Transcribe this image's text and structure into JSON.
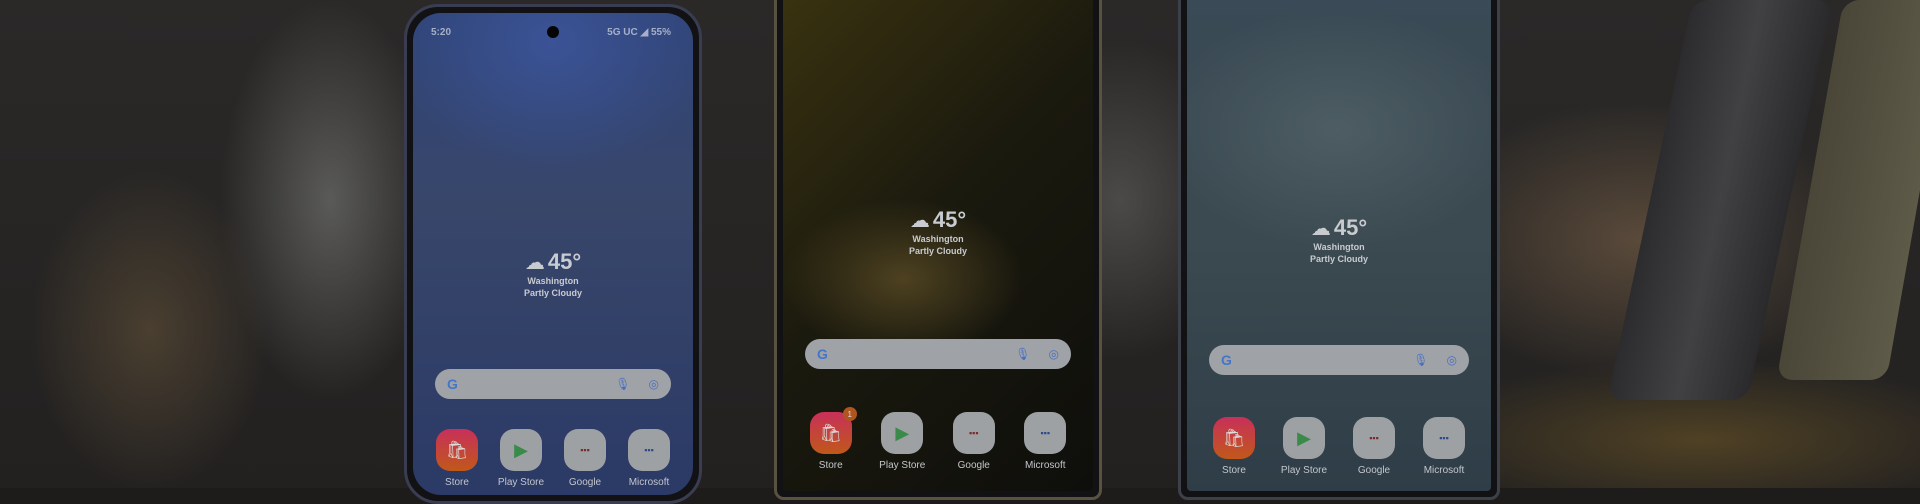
{
  "status": {
    "time": "5:20",
    "network": "5G UC",
    "battery": "55%"
  },
  "weather": {
    "temperature": "45°",
    "location": "Washington",
    "condition": "Partly Cloudy",
    "icon": "partly-cloudy-night-icon"
  },
  "search": {
    "logo": "G",
    "mic_icon": "microphone-icon",
    "lens_icon": "google-lens-icon"
  },
  "apps": [
    {
      "label": "Store",
      "icon": "galaxy-store-icon"
    },
    {
      "label": "Play Store",
      "icon": "play-store-icon"
    },
    {
      "label": "Google",
      "icon": "folder-icon"
    },
    {
      "label": "Microsoft",
      "icon": "folder-icon"
    }
  ],
  "store_badge": "1"
}
